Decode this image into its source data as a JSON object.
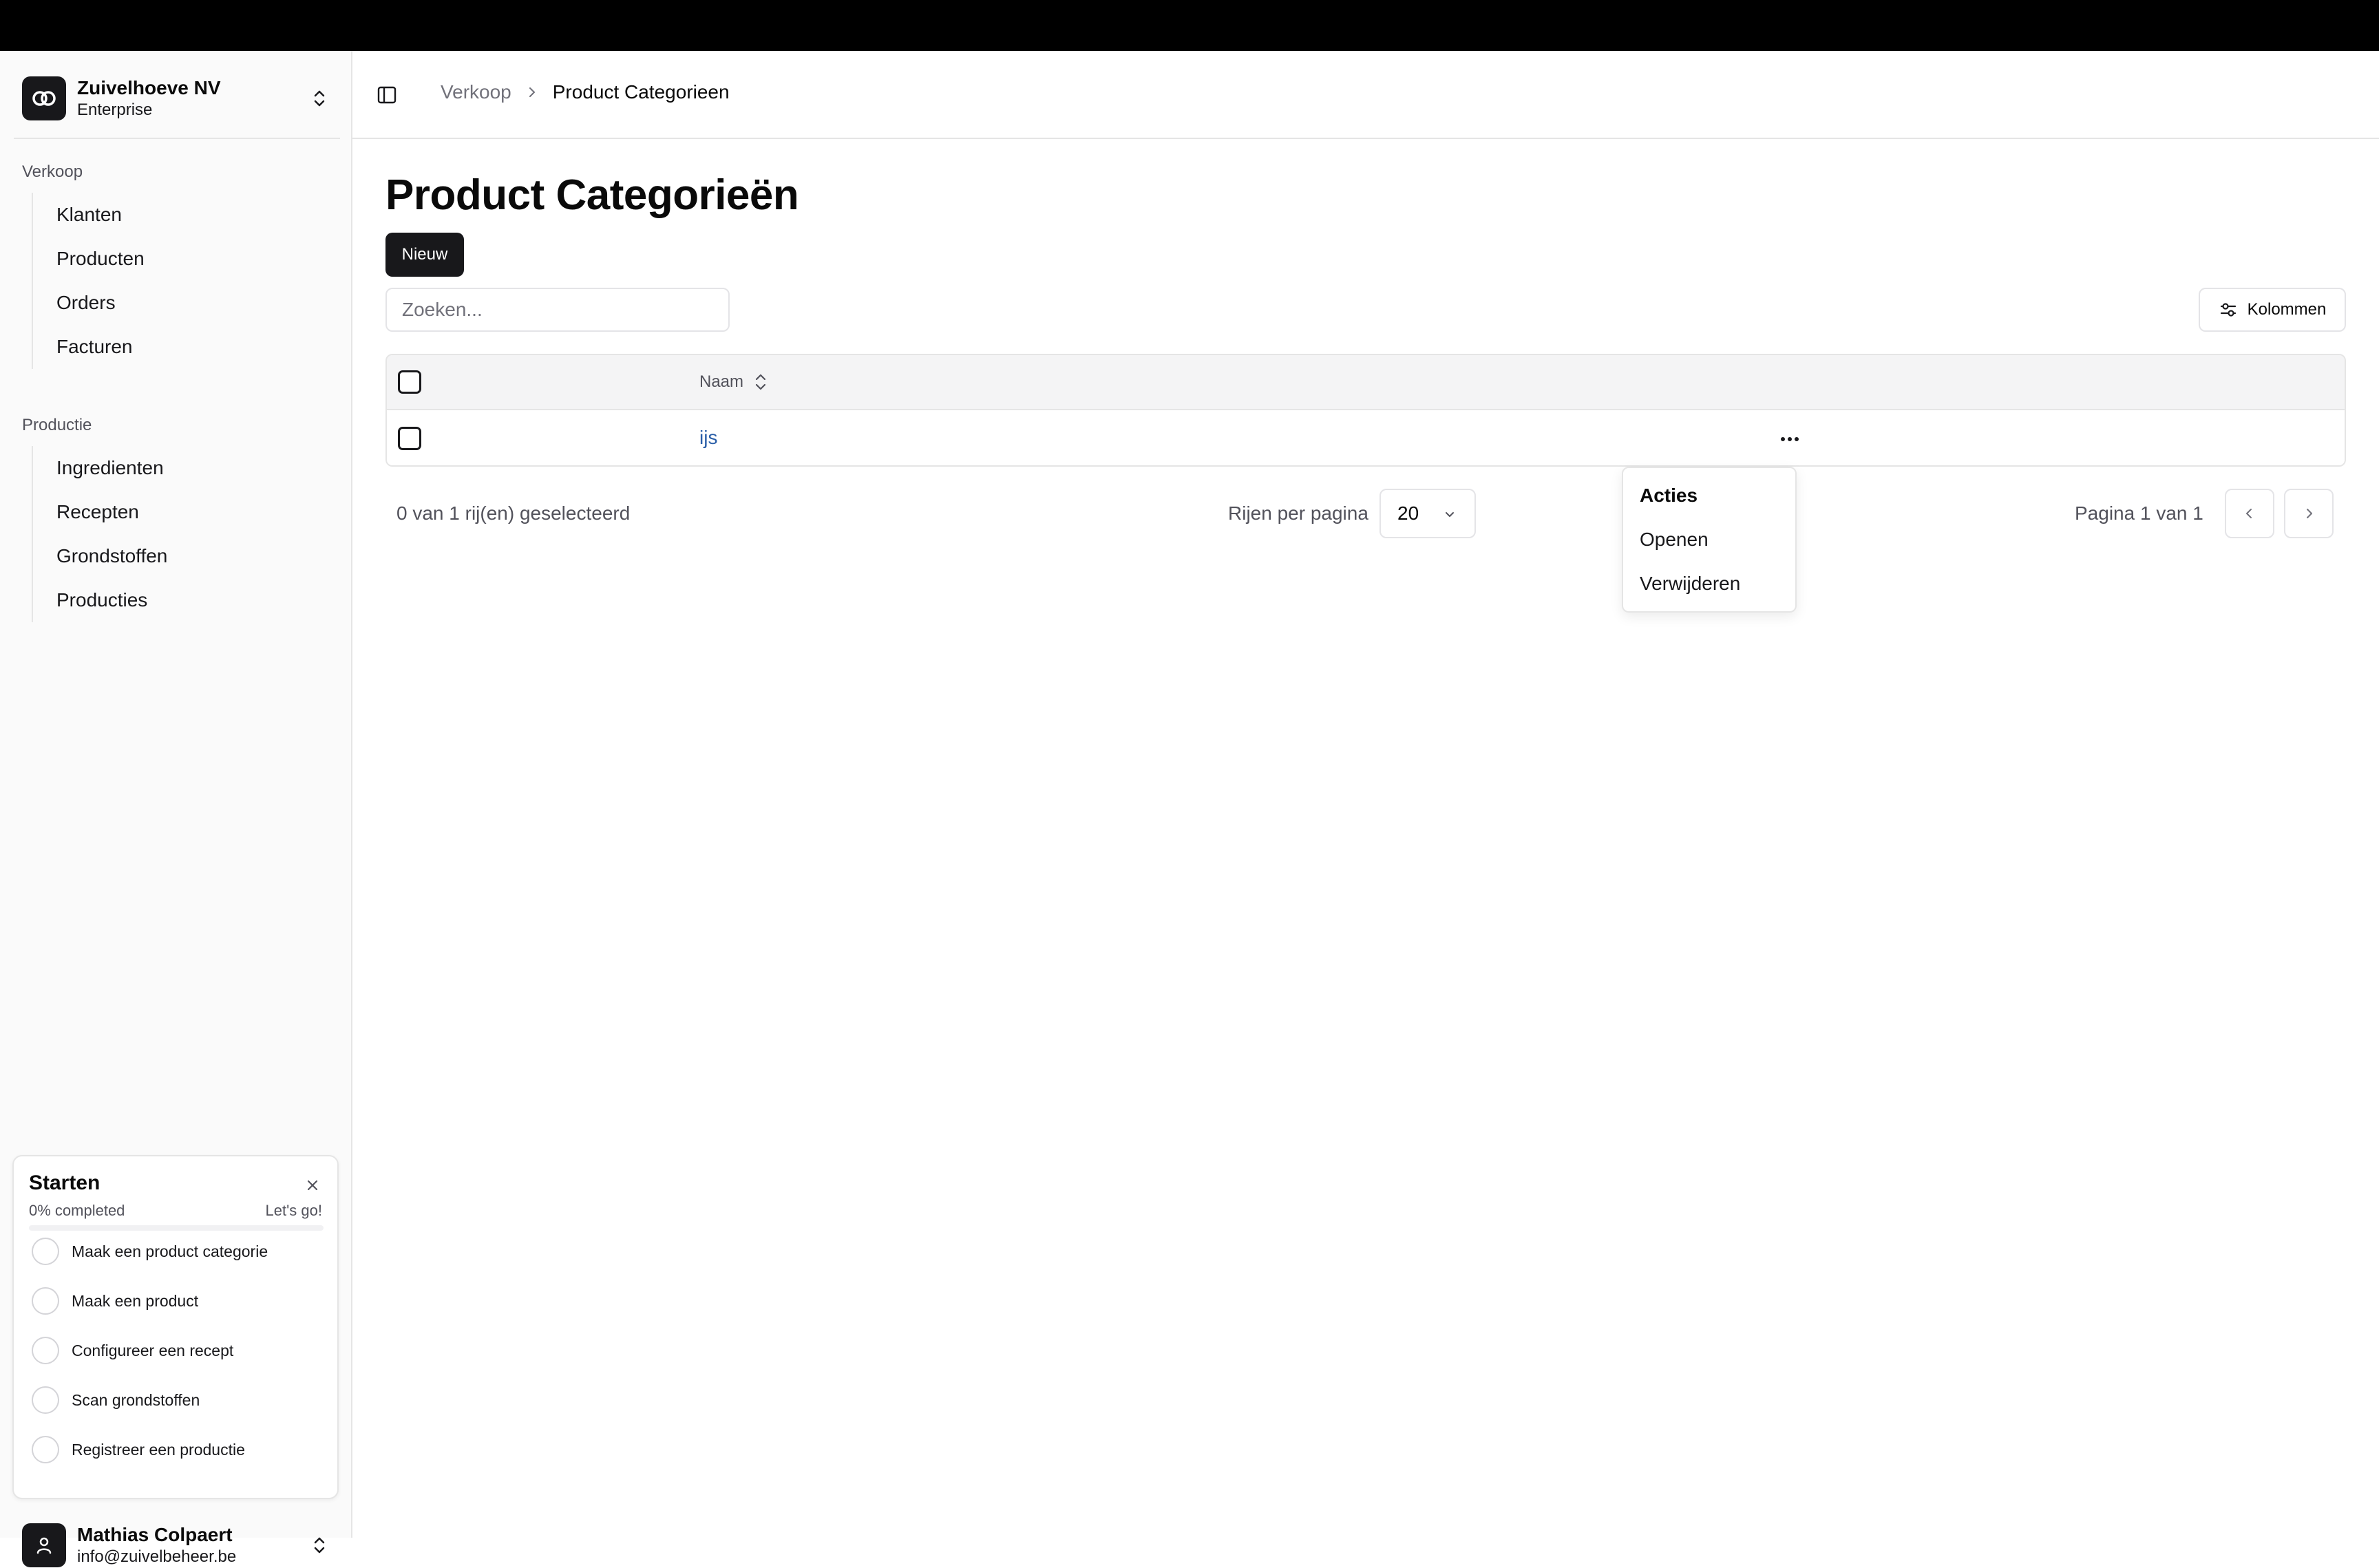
{
  "org": {
    "name": "Zuivelhoeve NV",
    "plan": "Enterprise"
  },
  "sidebar": {
    "groups": [
      {
        "label": "Verkoop",
        "items": [
          {
            "label": "Klanten"
          },
          {
            "label": "Producten"
          },
          {
            "label": "Orders"
          },
          {
            "label": "Facturen"
          }
        ]
      },
      {
        "label": "Productie",
        "items": [
          {
            "label": "Ingredienten"
          },
          {
            "label": "Recepten"
          },
          {
            "label": "Grondstoffen"
          },
          {
            "label": "Producties"
          }
        ]
      }
    ]
  },
  "onboarding": {
    "title": "Starten",
    "progress_label": "0% completed",
    "progress_value": 0,
    "cta": "Let's go!",
    "tasks": [
      {
        "label": "Maak een product categorie"
      },
      {
        "label": "Maak een product"
      },
      {
        "label": "Configureer een recept"
      },
      {
        "label": "Scan grondstoffen"
      },
      {
        "label": "Registreer een productie"
      }
    ]
  },
  "user": {
    "name": "Mathias Colpaert",
    "email": "info@zuivelbeheer.be"
  },
  "header": {
    "breadcrumb": {
      "parent": "Verkoop",
      "current": "Product Categorieen"
    }
  },
  "main": {
    "title": "Product Categorieën",
    "new_button": "Nieuw",
    "search": {
      "placeholder": "Zoeken...",
      "value": ""
    },
    "columns_button": "Kolommen",
    "table": {
      "columns": [
        {
          "label": "Naam"
        }
      ],
      "rows": [
        {
          "naam": "ijs"
        }
      ]
    },
    "footer": {
      "selection": "0 van 1 rij(en) geselecteerd",
      "rows_per_page_label": "Rijen per pagina",
      "rows_per_page": "20",
      "page_info": "Pagina 1 van 1"
    }
  },
  "actions_menu": {
    "label": "Acties",
    "items": [
      {
        "label": "Openen"
      },
      {
        "label": "Verwijderen"
      }
    ]
  },
  "colors": {
    "primary": "#18181b",
    "link": "#2b5fa8",
    "border": "#e5e5e5",
    "muted_text": "#52525b"
  }
}
